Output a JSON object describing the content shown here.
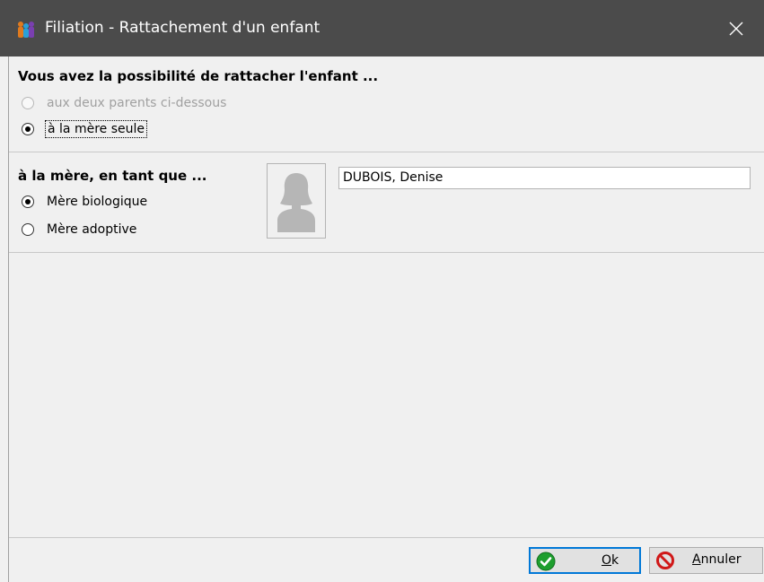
{
  "window": {
    "title": "Filiation - Rattachement d'un enfant",
    "titlebar_color": "#4b4b4b"
  },
  "section1": {
    "heading": "Vous avez la possibilité de rattacher l'enfant ...",
    "options": [
      {
        "label": "aux deux parents ci-dessous",
        "checked": false,
        "disabled": true
      },
      {
        "label": "à la mère seule",
        "checked": true,
        "disabled": false,
        "focused": true
      }
    ]
  },
  "section2": {
    "heading": "à la mère, en tant que ...",
    "options": [
      {
        "label": "Mère biologique",
        "checked": true
      },
      {
        "label": "Mère adoptive",
        "checked": false
      }
    ],
    "parent_name": "DUBOIS, Denise",
    "photo_icon": "female-silhouette-icon"
  },
  "buttons": {
    "ok": {
      "mnemonic": "O",
      "rest": "k",
      "icon": "check-circle-icon",
      "icon_color": "#1e9e2e"
    },
    "cancel": {
      "mnemonic": "A",
      "rest": "nnuler",
      "icon": "no-entry-icon",
      "icon_color": "#d01818"
    }
  }
}
